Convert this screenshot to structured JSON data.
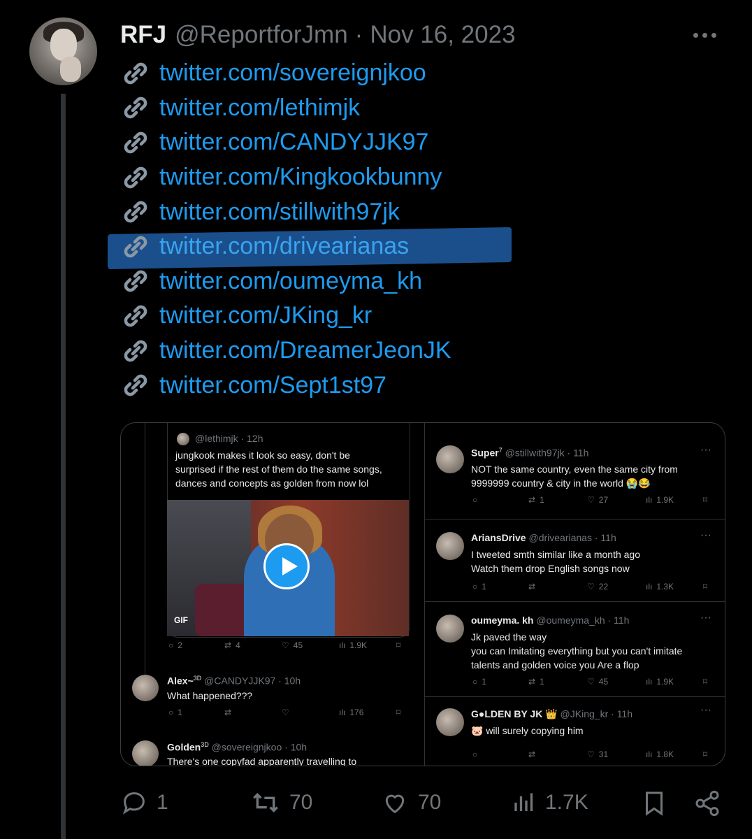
{
  "tweet": {
    "name": "RFJ",
    "handle": "@ReportforJmn",
    "separator": "·",
    "date": "Nov 16, 2023",
    "links": [
      "twitter.com/sovereignjkoo",
      "twitter.com/lethimjk",
      "twitter.com/CANDYJJK97",
      "twitter.com/Kingkookbunny",
      "twitter.com/stillwith97jk",
      "twitter.com/drivearianas",
      "twitter.com/oumeyma_kh",
      "twitter.com/JKing_kr",
      "twitter.com/DreamerJeonJK",
      "twitter.com/Sept1st97"
    ],
    "highlighted_link_index": 5,
    "stats": {
      "replies": "1",
      "retweets": "70",
      "likes": "70",
      "views": "1.7K"
    }
  },
  "embedded": {
    "left": {
      "quote": {
        "handle": "@lethimjk",
        "time": "12h",
        "text_lines": [
          "jungkook makes it look so easy, don't be",
          "surprised if the rest of them do the same songs,",
          "dances and concepts as golden from now lol"
        ],
        "gif_label": "GIF",
        "counts": {
          "replies": "2",
          "retweets": "4",
          "likes": "45",
          "views": "1.9K"
        }
      },
      "reply1": {
        "name": "Alex~",
        "badge": "3D",
        "handle": "@CANDYJJK97",
        "time": "10h",
        "text": "What happened???",
        "counts": {
          "replies": "1",
          "retweets": "",
          "likes": "",
          "views": "176"
        }
      },
      "reply2": {
        "name": "Golden",
        "badge": "3D",
        "handle": "@sovereignjkoo",
        "time": "10h",
        "text": "There's one copyfad apparently travelling to"
      }
    },
    "right": [
      {
        "name": "Super",
        "badge": "7",
        "handle": "@stillwith97jk",
        "time": "11h",
        "lines": [
          "NOT the same country, even the same city from",
          "9999999 country & city in the world 😭😂"
        ],
        "counts": {
          "replies": "",
          "retweets": "1",
          "likes": "27",
          "views": "1.9K"
        }
      },
      {
        "name": "AriansDrive",
        "handle": "@drivearianas",
        "time": "11h",
        "lines": [
          "I tweeted smth similar like a month ago",
          "Watch them drop English songs now"
        ],
        "counts": {
          "replies": "1",
          "retweets": "",
          "likes": "22",
          "views": "1.3K"
        }
      },
      {
        "name": "oumeyma. kh",
        "handle": "@oumeyma_kh",
        "time": "11h",
        "lines": [
          "Jk paved the way",
          " you can Imitating everything but you can't imitate",
          "talents and golden voice you Are a flop"
        ],
        "counts": {
          "replies": "1",
          "retweets": "1",
          "likes": "45",
          "views": "1.9K"
        }
      },
      {
        "name": "G●LDEN BY JK 👑",
        "handle": "@JKing_kr",
        "time": "11h",
        "lines": [
          "🐷 will surely copying him"
        ],
        "counts": {
          "replies": "",
          "retweets": "",
          "likes": "31",
          "views": "1.8K"
        }
      }
    ]
  }
}
